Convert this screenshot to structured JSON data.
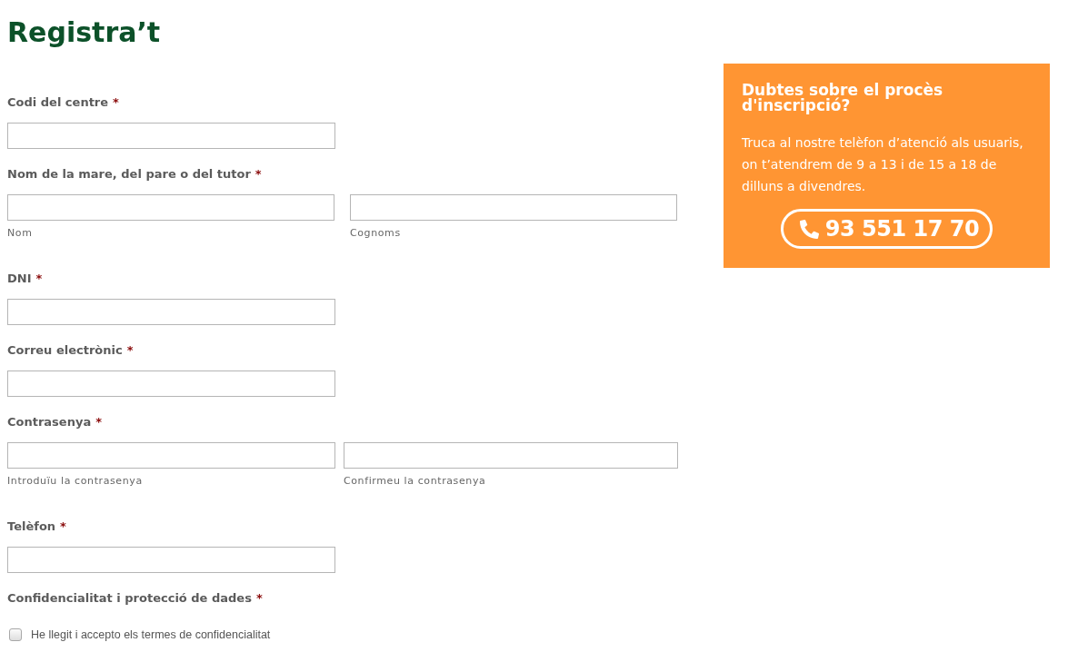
{
  "page_title": "Registra’t",
  "form": {
    "fields": [
      {
        "kind": "single",
        "label": "Codi del centre",
        "required_mark": "*"
      },
      {
        "kind": "name",
        "label": "Nom de la mare, del pare o del tutor",
        "required_mark": "*",
        "captions": [
          "Nom",
          "Cognoms"
        ]
      },
      {
        "kind": "single",
        "label": "DNI",
        "required_mark": "*"
      },
      {
        "kind": "single",
        "label": "Correu electrònic",
        "required_mark": "*"
      },
      {
        "kind": "password",
        "label": "Contrasenya",
        "required_mark": "*",
        "captions": [
          "Introduïu la contrasenya",
          "Confirmeu la contrasenya"
        ]
      },
      {
        "kind": "single",
        "label": "Telèfon",
        "required_mark": "*"
      },
      {
        "kind": "checkbox",
        "label": "Confidencialitat i protecció de dades",
        "required_mark": "*",
        "option": {
          "label": "He llegit i accepto els termes de confidencialitat",
          "checked": false
        }
      }
    ]
  },
  "help_box": {
    "title": "Dubtes sobre el procès d'inscripció?",
    "text": "Truca al nostre telèfon d’atenció als usuaris, on t’atendrem de 9 a 13 i de 15 a 18 de dilluns a divendres.",
    "phone": "93 551 17 70"
  }
}
